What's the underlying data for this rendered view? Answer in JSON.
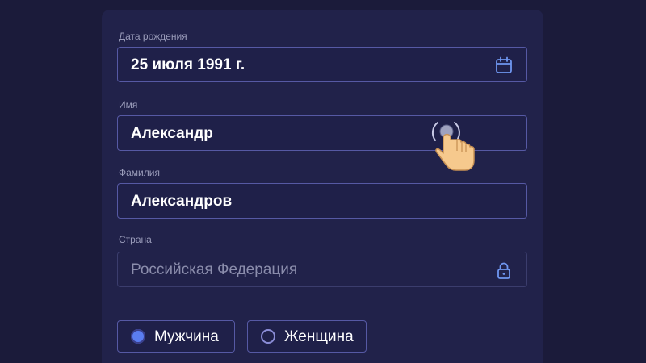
{
  "form": {
    "birth_date": {
      "label": "Дата рождения",
      "value": "25 июля 1991 г.",
      "icon": "calendar-icon"
    },
    "first_name": {
      "label": "Имя",
      "value": "Александр"
    },
    "last_name": {
      "label": "Фамилия",
      "value": "Александров"
    },
    "country": {
      "label": "Страна",
      "value": "Российская Федерация",
      "icon": "lock-icon"
    },
    "gender": {
      "options": [
        {
          "label": "Мужчина",
          "selected": true
        },
        {
          "label": "Женщина",
          "selected": false
        }
      ]
    }
  },
  "overlay": {
    "cursor_icon": "tap-hand-cursor-icon"
  },
  "colors": {
    "background": "#1b1b3a",
    "card": "#21224a",
    "border": "#5659a4",
    "accent": "#5a7df0",
    "label": "#9a9cba"
  }
}
